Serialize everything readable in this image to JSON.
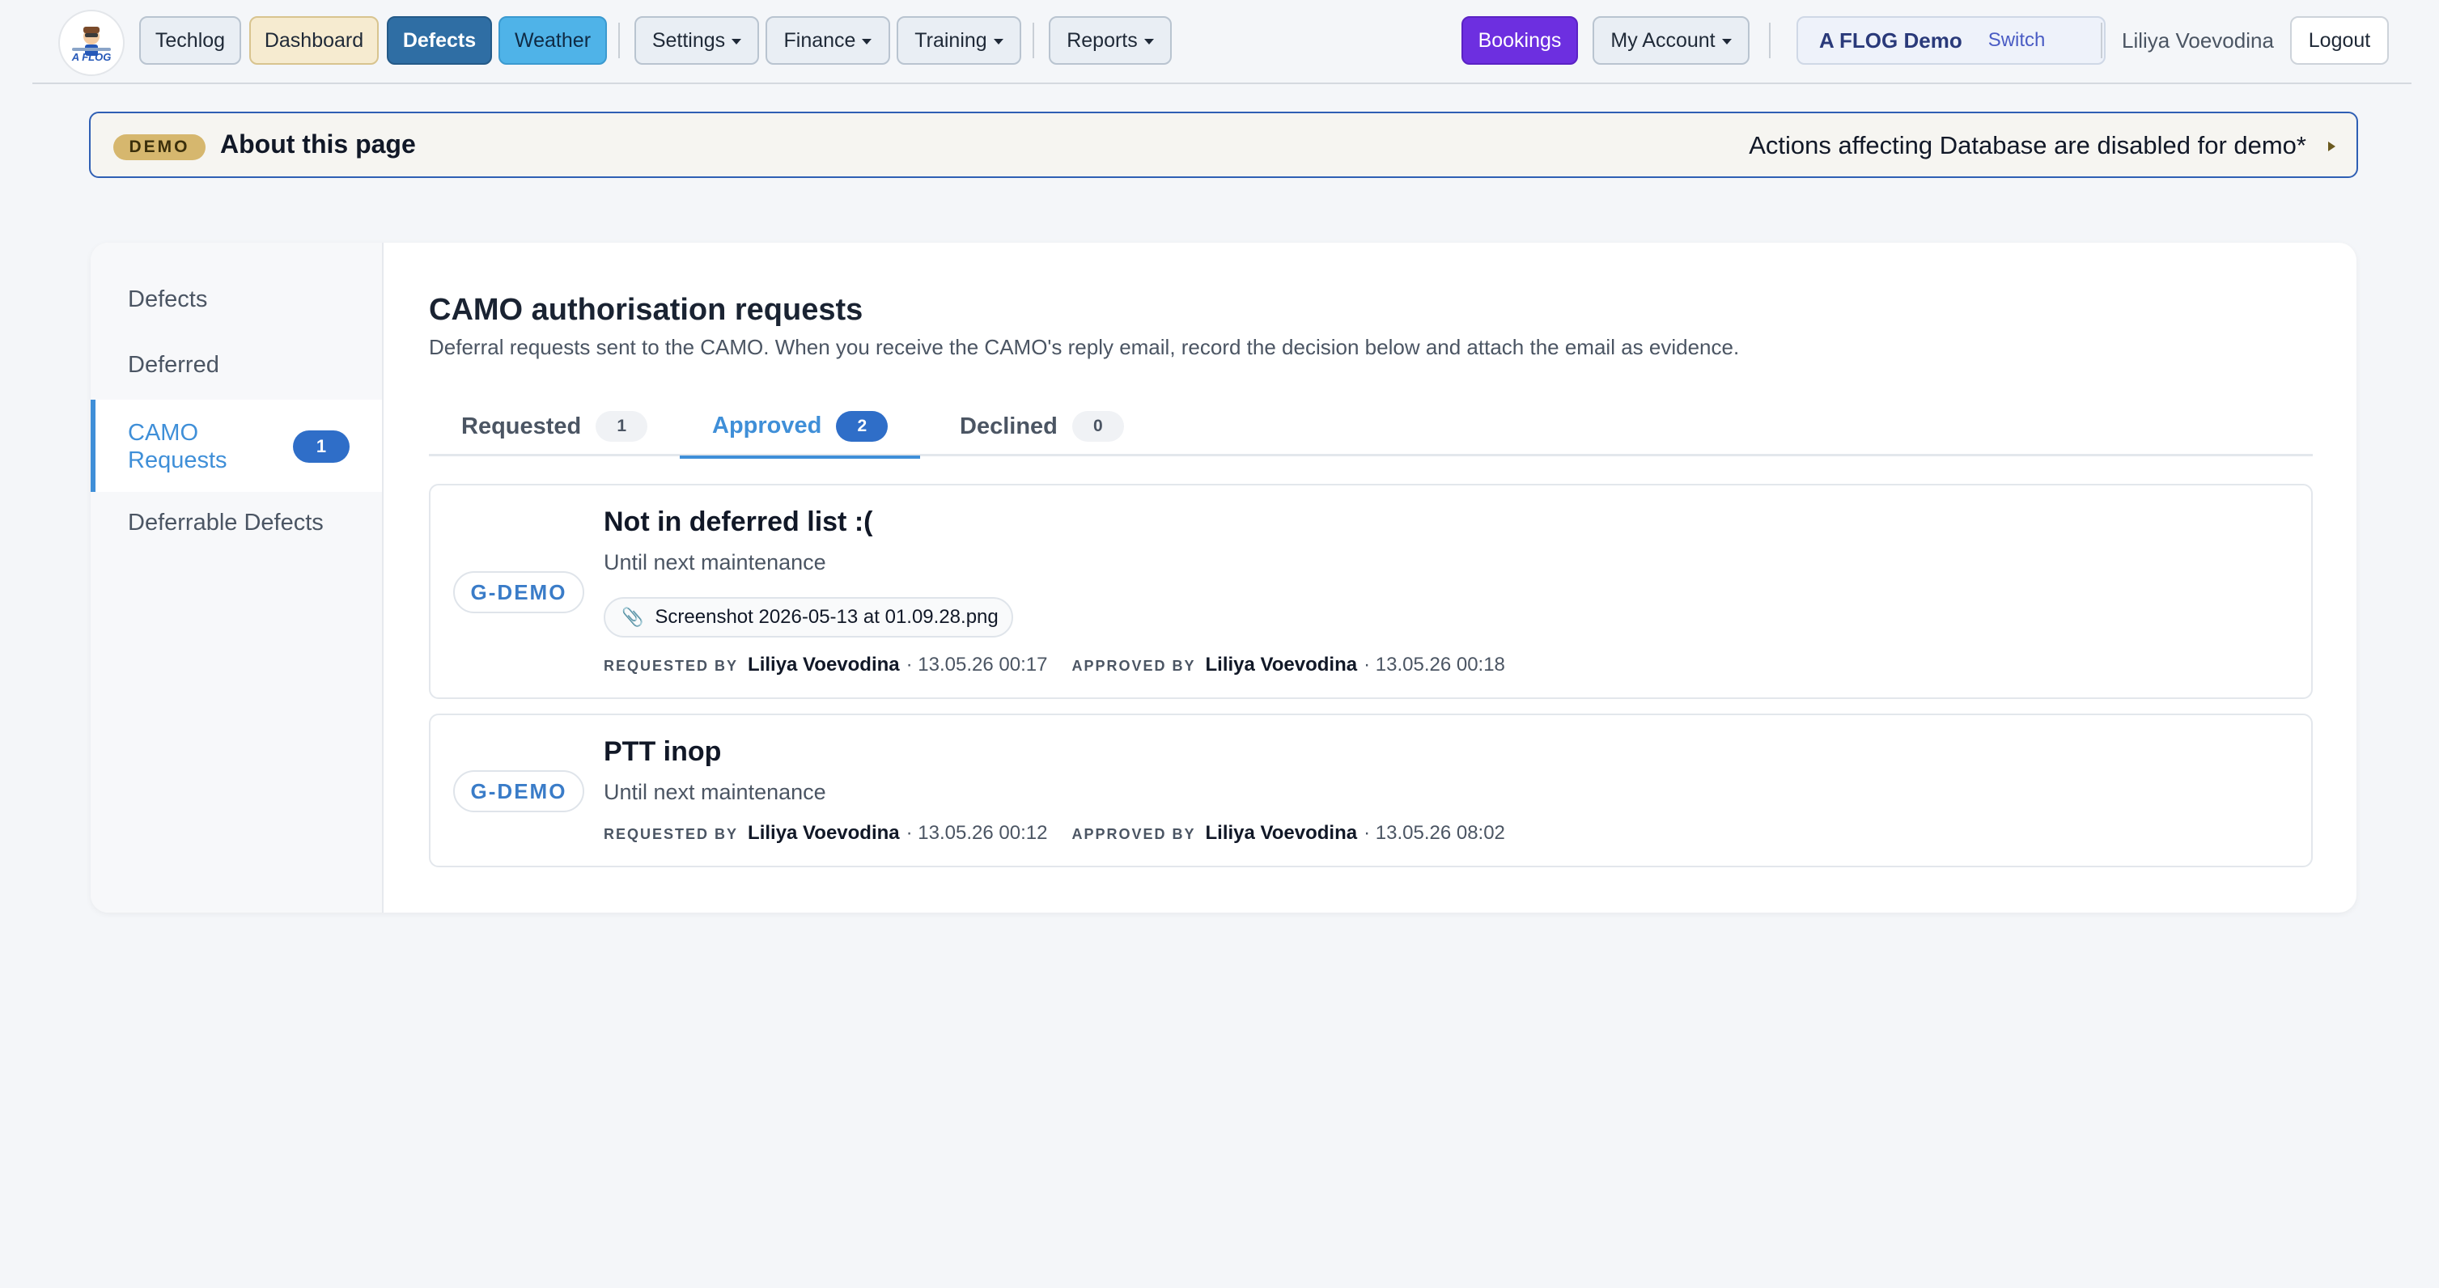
{
  "nav": {
    "logo_text": "A FLOG",
    "items": [
      {
        "label": "Techlog"
      },
      {
        "label": "Dashboard"
      },
      {
        "label": "Defects"
      },
      {
        "label": "Weather"
      },
      {
        "label": "Settings"
      },
      {
        "label": "Finance"
      },
      {
        "label": "Training"
      },
      {
        "label": "Reports"
      }
    ],
    "bookings_label": "Bookings",
    "my_account_label": "My Account",
    "org_name": "A FLOG Demo",
    "switch_label": "Switch",
    "user_name": "Liliya Voevodina",
    "logout_label": "Logout",
    "colors": {
      "defects_active": "#2f6ea4",
      "weather": "#4fb3e8",
      "dashboard": "#f6ebd0",
      "bookings": "#6d2fe0"
    }
  },
  "banner": {
    "badge": "DEMO",
    "title": "About this page",
    "note": "Actions affecting Database are disabled for demo*"
  },
  "sidebar": {
    "items": [
      {
        "label": "Defects"
      },
      {
        "label": "Deferred"
      },
      {
        "label": "CAMO Requests",
        "badge": "1"
      },
      {
        "label": "Deferrable Defects"
      }
    ]
  },
  "page": {
    "title": "CAMO authorisation requests",
    "subtitle": "Deferral requests sent to the CAMO. When you receive the CAMO's reply email, record the decision below and attach the email as evidence."
  },
  "tabs": [
    {
      "label": "Requested",
      "count": "1"
    },
    {
      "label": "Approved",
      "count": "2"
    },
    {
      "label": "Declined",
      "count": "0"
    }
  ],
  "requests": [
    {
      "registration": "G-DEMO",
      "title": "Not in deferred list :(",
      "description": "Until next maintenance",
      "attachment": "Screenshot 2026-05-13 at 01.09.28.png",
      "requested_label": "REQUESTED BY",
      "requested_by": "Liliya Voevodina",
      "requested_at": "· 13.05.26 00:17",
      "approved_label": "APPROVED BY",
      "approved_by": "Liliya Voevodina",
      "approved_at": "· 13.05.26 00:18"
    },
    {
      "registration": "G-DEMO",
      "title": "PTT inop",
      "description": "Until next maintenance",
      "requested_label": "REQUESTED BY",
      "requested_by": "Liliya Voevodina",
      "requested_at": "· 13.05.26 00:12",
      "approved_label": "APPROVED BY",
      "approved_by": "Liliya Voevodina",
      "approved_at": "· 13.05.26 08:02"
    }
  ]
}
